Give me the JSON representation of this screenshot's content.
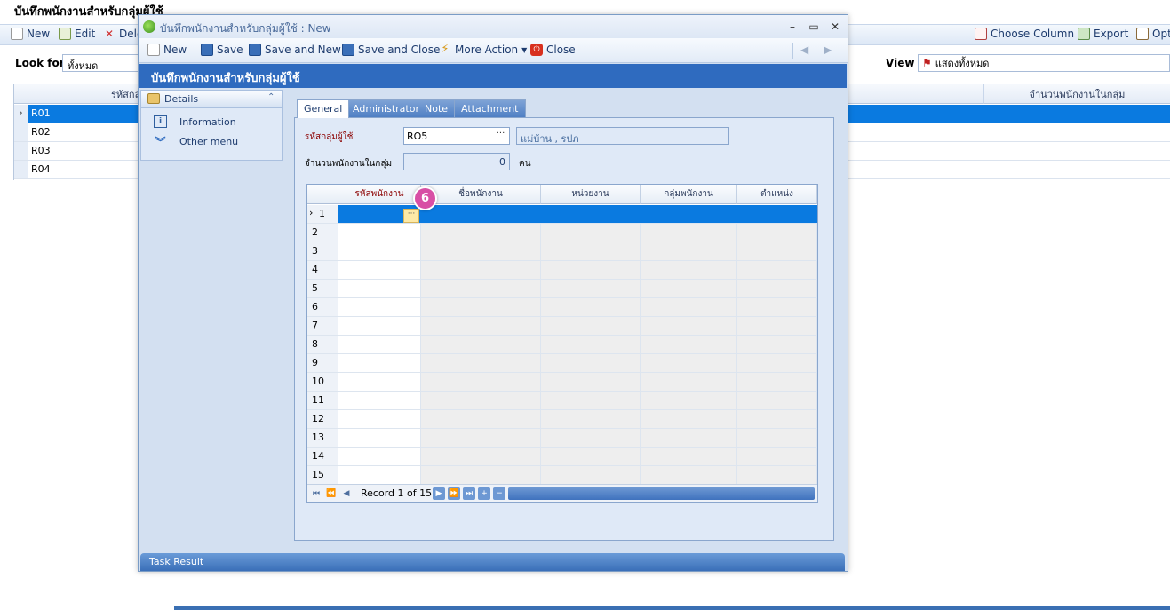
{
  "background": {
    "title": "บันทึกพนักงานสำหรับกลุ่มผู้ใช้",
    "toolbar": {
      "new": "New",
      "edit": "Edit",
      "delete": "Dele",
      "choose_column": "Choose Column",
      "export": "Export",
      "options": "Opt"
    },
    "look_for_label": "Look for",
    "look_for_value": "ทั้งหมด",
    "view_label": "View",
    "view_value": "แสดงทั้งหมด",
    "grid_headers": {
      "code": "รหัสกล",
      "count": "จำนวนพนักงานในกลุ่ม"
    },
    "rows": [
      "R01",
      "R02",
      "R03",
      "R04"
    ]
  },
  "modal": {
    "title": "บันทึกพนักงานสำหรับกลุ่มผู้ใช้ : New",
    "toolbar": {
      "new": "New",
      "save": "Save",
      "save_new": "Save and New",
      "save_close": "Save and Close",
      "more_action": "More Action",
      "close": "Close"
    },
    "header": "บันทึกพนักงานสำหรับกลุ่มผู้ใช้",
    "left_panel": {
      "title": "Details",
      "items": [
        "Information",
        "Other menu"
      ]
    },
    "tabs": [
      "General",
      "Administrator",
      "Note",
      "Attachment"
    ],
    "form": {
      "group_code_label": "รหัสกลุ่มผู้ใช้",
      "group_code_value": "RO5",
      "group_name_value": "แม่บ้าน , รปภ",
      "emp_count_label": "จำนวนพนักงานในกลุ่ม",
      "emp_count_value": "0",
      "emp_count_unit": "คน"
    },
    "grid": {
      "headers": [
        "รหัสพนักงาน",
        "ชื่อพนักงาน",
        "หน่วยงาน",
        "กลุ่มพนักงาน",
        "ตำแหน่ง"
      ],
      "row_numbers": [
        "1",
        "2",
        "3",
        "4",
        "5",
        "6",
        "7",
        "8",
        "9",
        "10",
        "11",
        "12",
        "13",
        "14",
        "15"
      ],
      "record_text": "Record 1 of 15",
      "step_badge": "6"
    },
    "task_result": "Task Result"
  },
  "colors": {
    "accent": "#2f6bbf",
    "selection": "#0a7ae0",
    "badge": "#d84fa5",
    "required_label": "#8b0000"
  }
}
